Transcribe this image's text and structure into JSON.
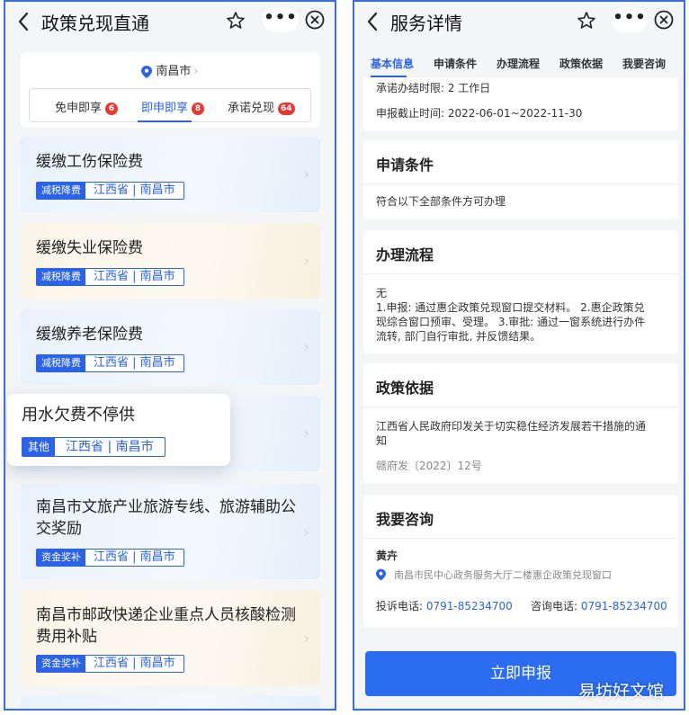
{
  "left": {
    "title": "政策兑现直通",
    "more_label": "•••",
    "location": "南昌市",
    "tabs": [
      {
        "label": "免申即享",
        "count": "6"
      },
      {
        "label": "即申即享",
        "count": "8"
      },
      {
        "label": "承诺兑现",
        "count": "64"
      }
    ],
    "items": [
      {
        "title": "缓缴工伤保险费",
        "category": "减税降费",
        "region": "江西省 | 南昌市"
      },
      {
        "title": "缓缴失业保险费",
        "category": "减税降费",
        "region": "江西省 | 南昌市"
      },
      {
        "title": "缓缴养老保险费",
        "category": "减税降费",
        "region": "江西省 | 南昌市"
      },
      {
        "title": "用水欠费不停供",
        "category": "其他",
        "region": "江西省 | 南昌市"
      },
      {
        "title_line1": "南昌市文旅产业旅游专线、旅游辅助公",
        "title_line2": "交奖励",
        "category": "资金奖补",
        "region": "江西省 | 南昌市"
      },
      {
        "title_line1": "南昌市邮政快递企业重点人员核酸检测",
        "title_line2": "费用补贴",
        "category": "资金奖补",
        "region": "江西省 | 南昌市"
      }
    ]
  },
  "right": {
    "title": "服务详情",
    "more_label": "•••",
    "tabs": [
      "基本信息",
      "申请条件",
      "办理流程",
      "政策依据",
      "我要咨询"
    ],
    "basic": {
      "limit_partial": "承诺办结时限: 2 工作日",
      "deadline": "申报截止时间: 2022-06-01~2022-11-30"
    },
    "conditions": {
      "heading": "申请条件",
      "text": "符合以下全部条件方可办理"
    },
    "process": {
      "heading": "办理流程",
      "line1": "无",
      "line2": "1.申报: 通过惠企政策兑现窗口提交材料。 2.惠企政策兑",
      "line3": "现综合窗口预审、受理。 3.审批: 通过一窗系统进行办件",
      "line4": "流转, 部门自行审批, 并反馈结果。"
    },
    "basis": {
      "heading": "政策依据",
      "line1": "江西省人民政府印发关于切实稳住经济发展若干措施的通",
      "line2": "知",
      "doc_no": "赣府发〔2022〕12号"
    },
    "consult": {
      "heading": "我要咨询",
      "name": "黄卉",
      "address": "南昌市民中心政务服务大厅二楼惠企政策兑现窗口",
      "complaint_label": "投诉电话: ",
      "complaint_phone": "0791-85234700",
      "consult_label": "咨询电话: ",
      "consult_phone": "0791-85234700"
    },
    "submit_label": "立即申报",
    "watermark": "易坊好文馆"
  },
  "colors": {
    "accent": "#2b62e6",
    "badge": "#e53935",
    "submit": "#2b6cf0"
  }
}
